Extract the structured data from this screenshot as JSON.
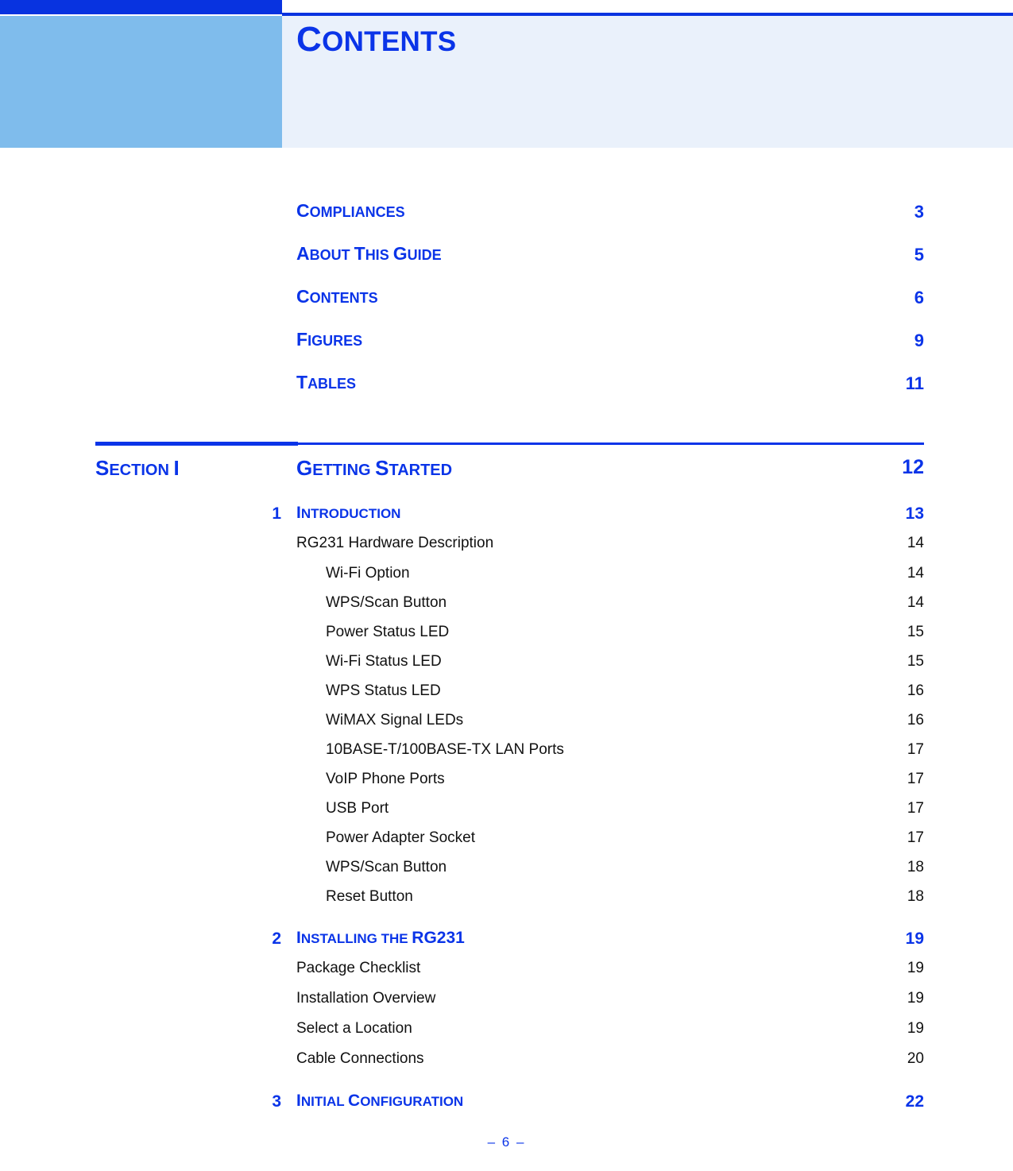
{
  "header": {
    "title_cap": "C",
    "title_rest": "ONTENTS"
  },
  "front_matter": [
    {
      "cap": "C",
      "rest": "OMPLIANCES",
      "page": "3"
    },
    {
      "cap": "A",
      "rest": "BOUT ",
      "page": "5",
      "cap2": "T",
      "rest2": "HIS ",
      "cap3": "G",
      "rest3": "UIDE"
    },
    {
      "cap": "C",
      "rest": "ONTENTS",
      "page": "6"
    },
    {
      "cap": "F",
      "rest": "IGURES",
      "page": "9"
    },
    {
      "cap": "T",
      "rest": "ABLES",
      "page": "11"
    }
  ],
  "section": {
    "name_cap": "S",
    "name_rest": "ECTION ",
    "name_numeral": "I",
    "title_cap": "G",
    "title_rest": "ETTING ",
    "title_cap2": "S",
    "title_rest2": "TARTED",
    "page": "12"
  },
  "chapters": [
    {
      "number": "1",
      "title_cap": "I",
      "title_rest": "NTRODUCTION",
      "page": "13",
      "entries": [
        {
          "level": 1,
          "label": "RG231 Hardware Description",
          "page": "14"
        },
        {
          "level": 2,
          "label": "Wi-Fi Option",
          "page": "14"
        },
        {
          "level": 2,
          "label": "WPS/Scan Button",
          "page": "14"
        },
        {
          "level": 2,
          "label": "Power Status LED",
          "page": "15"
        },
        {
          "level": 2,
          "label": "Wi-Fi Status LED",
          "page": "15"
        },
        {
          "level": 2,
          "label": "WPS Status LED",
          "page": "16"
        },
        {
          "level": 2,
          "label": "WiMAX Signal LEDs",
          "page": "16"
        },
        {
          "level": 2,
          "label": "10BASE-T/100BASE-TX LAN Ports",
          "page": "17"
        },
        {
          "level": 2,
          "label": "VoIP Phone Ports",
          "page": "17"
        },
        {
          "level": 2,
          "label": "USB Port",
          "page": "17"
        },
        {
          "level": 2,
          "label": "Power Adapter Socket",
          "page": "17"
        },
        {
          "level": 2,
          "label": "WPS/Scan Button",
          "page": "18"
        },
        {
          "level": 2,
          "label": "Reset Button",
          "page": "18"
        }
      ]
    },
    {
      "number": "2",
      "title_cap": "I",
      "title_rest": "NSTALLING THE ",
      "title_model": "RG231",
      "page": "19",
      "entries": [
        {
          "level": 1,
          "label": "Package Checklist",
          "page": "19"
        },
        {
          "level": 1,
          "label": "Installation Overview",
          "page": "19"
        },
        {
          "level": 1,
          "label": "Select a Location",
          "page": "19"
        },
        {
          "level": 1,
          "label": "Cable Connections",
          "page": "20"
        }
      ]
    },
    {
      "number": "3",
      "title_cap": "I",
      "title_rest": "NITIAL ",
      "title_cap2": "C",
      "title_rest2": "ONFIGURATION",
      "page": "22",
      "entries": []
    }
  ],
  "footer": {
    "text": "–  6  –"
  },
  "colors": {
    "accent_blue": "#0A34E8",
    "header_bar": "#0833E0",
    "header_block_light": "#7FBCEC",
    "header_panel": "#EAF1FB",
    "body_text": "#111111"
  }
}
